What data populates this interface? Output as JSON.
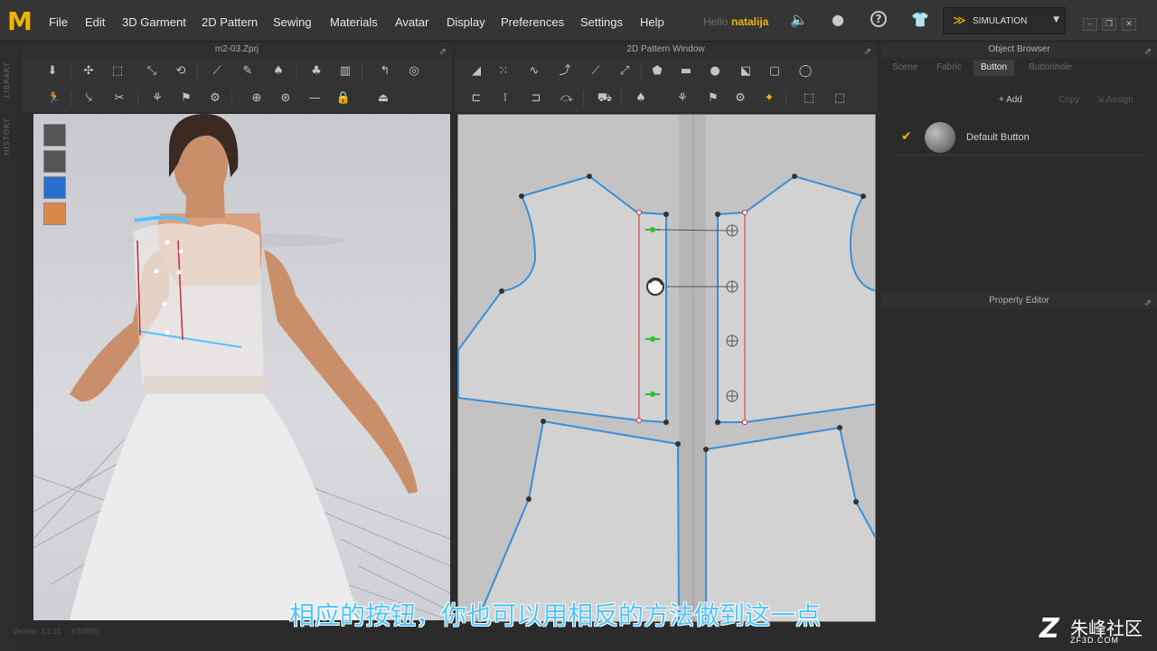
{
  "app": {
    "logo": "M",
    "menu": [
      "File",
      "Edit",
      "3D Garment",
      "2D Pattern",
      "Sewing",
      "Materials",
      "Avatar",
      "Display",
      "Preferences",
      "Settings",
      "Help"
    ],
    "hello": "Hello",
    "username": "natalija",
    "simulation_label": "SIMULATION",
    "icons": [
      "speaker-icon",
      "user-icon",
      "help-icon",
      "garment-icon"
    ]
  },
  "sidebar": {
    "items": [
      "LIBRARY",
      "HISTORY"
    ]
  },
  "viewport3d": {
    "title": "m2-03.Zprj"
  },
  "viewport2d": {
    "title": "2D Pattern Window"
  },
  "object_browser": {
    "title": "Object Browser",
    "tabs": [
      "Scene",
      "Fabric",
      "Button",
      "Buttonhole"
    ],
    "active_tab": "Button",
    "actions": {
      "add": "Add",
      "copy": "Copy",
      "assign": "Assign"
    },
    "items": [
      {
        "label": "Default Button",
        "selected": true
      }
    ]
  },
  "property_editor": {
    "title": "Property Editor"
  },
  "footer": {
    "version": "Version: 3.1.21",
    "build": "(r24655)"
  },
  "subtitle": "相应的按钮，你也可以用相反的方法做到这一点",
  "watermark": {
    "brand": "朱峰社区",
    "url": "ZF3D.COM"
  },
  "colors": {
    "accent": "#f0b400",
    "subtitle": "#4fc3ff",
    "pattern_line": "#3a8fd8",
    "seam": "#cc3030"
  }
}
